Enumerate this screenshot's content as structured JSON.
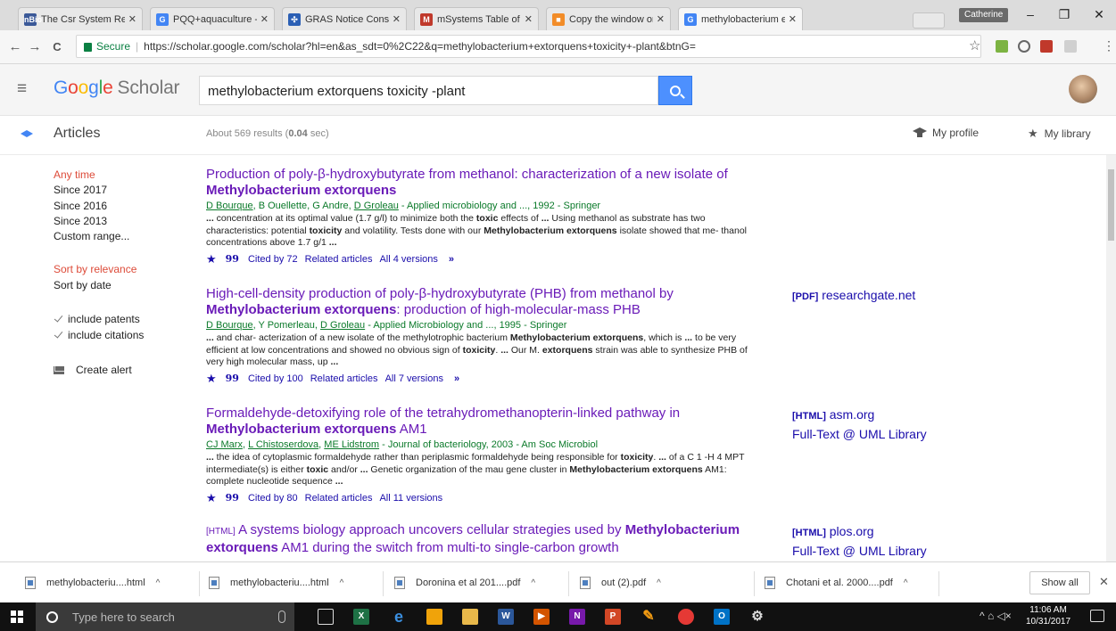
{
  "browser": {
    "tabs": [
      {
        "title": "The Csr System Regula",
        "favicon_color": "#3b5998",
        "favicon_text": "nBio"
      },
      {
        "title": "PQQ+aquaculture - G",
        "favicon_color": "#4285f4",
        "favicon_text": "G"
      },
      {
        "title": "GRAS Notice Consolid",
        "favicon_color": "#2b5fb4",
        "favicon_text": "✣"
      },
      {
        "title": "mSystems Table of Co",
        "favicon_color": "#c0392b",
        "favicon_text": "M"
      },
      {
        "title": "Copy the window or a",
        "favicon_color": "#f28c28",
        "favicon_text": "■"
      },
      {
        "title": "methylobacterium exte",
        "favicon_color": "#4285f4",
        "favicon_text": "G"
      }
    ],
    "user_badge": "Catherine",
    "window_controls": {
      "minimize": "–",
      "maximize": "❐",
      "close": "✕"
    },
    "nav": {
      "back": "←",
      "forward": "→",
      "reload": "C"
    },
    "secure_label": "Secure",
    "url": "https://scholar.google.com/scholar?hl=en&as_sdt=0%2C22&q=methylobacterium+extorquens+toxicity+-plant&btnG=",
    "bookmark_glyph": "☆",
    "menu_glyph": "⋮"
  },
  "scholar": {
    "logo": {
      "google": [
        "G",
        "o",
        "o",
        "g",
        "l",
        "e"
      ],
      "scholar": "Scholar"
    },
    "hamburger_glyph": "≡",
    "search_query": "methylobacterium extorquens toxicity -plant",
    "articles_label": "Articles",
    "results_count_prefix": "About 569 results (",
    "results_count_time": "0.04",
    "results_count_suffix": " sec)",
    "my_profile": "My profile",
    "my_library": "My library"
  },
  "sidebar": {
    "time_filters": [
      "Any time",
      "Since 2017",
      "Since 2016",
      "Since 2013",
      "Custom range..."
    ],
    "sort": [
      "Sort by relevance",
      "Sort by date"
    ],
    "include_patents": "include patents",
    "include_citations": "include citations",
    "create_alert": "Create alert"
  },
  "results": [
    {
      "title_plain": "Production of poly-β-hydroxybutyrate from methanol: characterization of a new isolate of ",
      "title_bold": "Methylobacterium extorquens",
      "title_after": "",
      "authors_linked": [
        "D Bourque"
      ],
      "authors_rest": ", B Ouellette, G Andre, ",
      "authors_linked2": "D Groleau",
      "authors_source": " - Applied microbiology and ..., 1992 - Springer",
      "snippet_html": "<b>...</b> concentration at its optimal value (1.7 g/l) to minimize both the <b>toxic</b> effects of <b>...</b> Using methanol as substrate has two characteristics: potential <b>toxicity</b> and volatility. Tests done with our <b>Methylobacterium extorquens</b> isolate showed that me- thanol concentrations above 1.7 g/1 <b>...</b>",
      "cited_by": "Cited by 72",
      "related": "Related articles",
      "versions": "All 4 versions",
      "side": []
    },
    {
      "title_plain": "High-cell-density production of poly-β-hydroxybutyrate (PHB) from methanol by ",
      "title_bold": "Methylobacterium extorquens",
      "title_after": ": production of high-molecular-mass PHB",
      "authors_linked": [
        "D Bourque"
      ],
      "authors_rest": ", Y Pomerleau, ",
      "authors_linked2": "D Groleau",
      "authors_source": " - Applied Microbiology and ..., 1995 - Springer",
      "snippet_html": "<b>...</b> and char- acterization of a new isolate of the methylotrophic bacterium <b>Methylobacterium extorquens</b>, which is <b>...</b> to be very efficient at low concentrations and showed no obvious sign of <b>toxicity</b>. <b>...</b> Our M. <b>extorquens</b> strain was able to synthesize PHB of very high molecular mass, up <b>...</b>",
      "cited_by": "Cited by 100",
      "related": "Related articles",
      "versions": "All 7 versions",
      "side": [
        {
          "format": "[PDF]",
          "label": "researchgate.net"
        }
      ]
    },
    {
      "title_plain": "Formaldehyde-detoxifying role of the tetrahydromethanopterin-linked pathway in ",
      "title_bold": "Methylobacterium extorquens",
      "title_after": " AM1",
      "authors_linked": [
        "CJ Marx",
        "L Chistoserdova",
        "ME Lidstrom"
      ],
      "authors_rest": "",
      "authors_linked2": "",
      "authors_source": " - Journal of bacteriology, 2003 - Am Soc Microbiol",
      "snippet_html": "<b>...</b> the idea of cytoplasmic formaldehyde rather than periplasmic formaldehyde being responsible for <b>toxicity</b>. <b>...</b> of a C 1 -H 4 MPT intermediate(s) is either <b>toxic</b> and/or <b>...</b> Genetic organization of the mau gene cluster in <b>Methylobacterium extorquens</b> AM1: complete nucleotide sequence <b>...</b>",
      "cited_by": "Cited by 80",
      "related": "Related articles",
      "versions": "All 11 versions",
      "side": [
        {
          "format": "[HTML]",
          "label": "asm.org"
        },
        {
          "format": "",
          "label": "Full-Text @ UML Library"
        }
      ]
    },
    {
      "title_tag": "[HTML]",
      "title_plain": " A systems biology approach uncovers cellular strategies used by ",
      "title_bold": "Methylobacterium extorquens",
      "title_after": " AM1 during the switch from multi-to single-carbon growth",
      "side": [
        {
          "format": "[HTML]",
          "label": "plos.org"
        },
        {
          "format": "",
          "label": "Full-Text @ UML Library"
        }
      ]
    }
  ],
  "downloads": [
    {
      "name": "methylobacteriu....html"
    },
    {
      "name": "methylobacteriu....html"
    },
    {
      "name": "Doronina et al 201....pdf"
    },
    {
      "name": "out (2).pdf"
    },
    {
      "name": "Chotani et al. 2000....pdf"
    }
  ],
  "downloads_show_all": "Show all",
  "downloads_close": "✕",
  "taskbar": {
    "search_placeholder": "Type here to search",
    "time": "11:06 AM",
    "date": "10/31/2017",
    "tray_glyphs": "^  ⌂  ◁×"
  }
}
